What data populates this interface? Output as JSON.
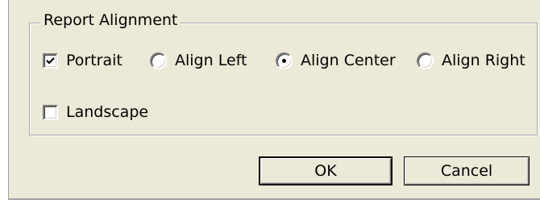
{
  "group": {
    "title": "Report Alignment"
  },
  "options": {
    "portrait": {
      "label": "Portrait",
      "checked": true
    },
    "landscape": {
      "label": "Landscape",
      "checked": false
    },
    "align_left": {
      "label": "Align Left",
      "selected": false
    },
    "align_center": {
      "label": "Align Center",
      "selected": true
    },
    "align_right": {
      "label": "Align Right",
      "selected": false
    }
  },
  "buttons": {
    "ok": "OK",
    "cancel": "Cancel"
  }
}
